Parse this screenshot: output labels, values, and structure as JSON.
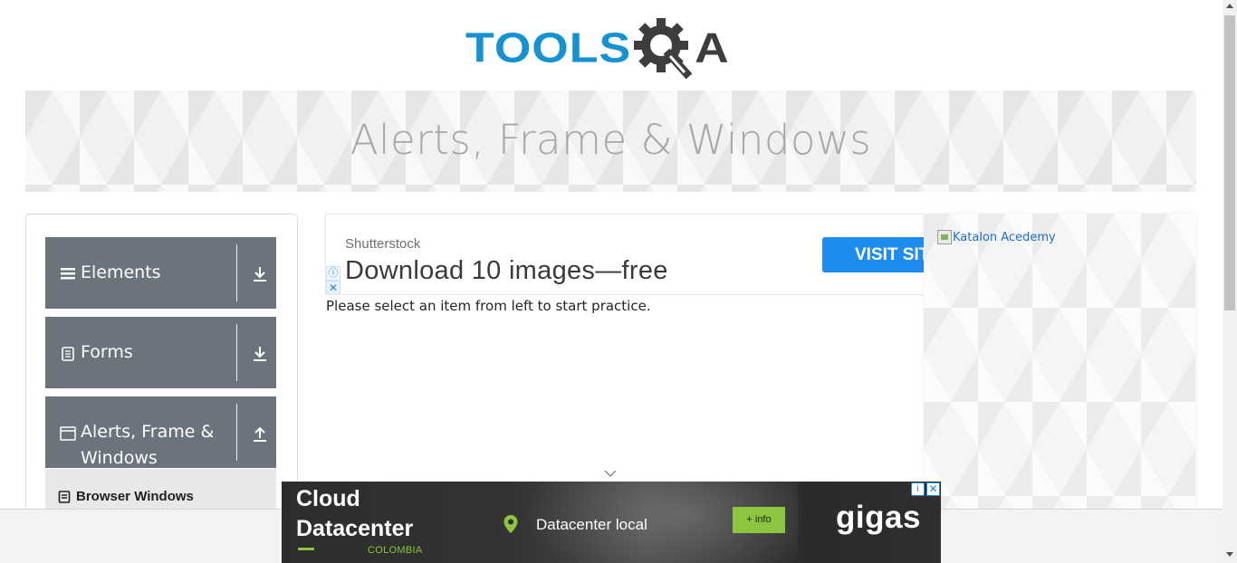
{
  "header": {
    "logo_left": "TOOLS",
    "logo_right": "A"
  },
  "banner": {
    "title": "Alerts, Frame & Windows"
  },
  "sidebar": {
    "groups": [
      {
        "label": "Elements",
        "icon": "hamburger-icon",
        "arrow": "download-arrow-icon"
      },
      {
        "label": "Forms",
        "icon": "document-icon",
        "arrow": "download-arrow-icon"
      },
      {
        "label_line1": "Alerts, Frame &",
        "label_line2": "Windows",
        "icon": "window-icon",
        "arrow": "upload-arrow-icon"
      }
    ],
    "submenu": [
      {
        "label": "Browser Windows",
        "icon": "list-icon"
      }
    ]
  },
  "top_ad": {
    "brand": "Shutterstock",
    "headline": "Download 10 images—free",
    "cta": "VISIT SITE",
    "info_glyph": "ⓘ",
    "close_glyph": "✕"
  },
  "main": {
    "practice_text": "Please select an item from left to start practice."
  },
  "right_ad": {
    "alt_text": "Katalon Acedemy"
  },
  "bottom_ad": {
    "title_line1": "Cloud",
    "title_line2": "Datacenter",
    "country": "COLOMBIA",
    "location_text": "Datacenter local",
    "info_button": "+ info",
    "brand": "gigas",
    "info_glyph": "i",
    "close_glyph": "✕"
  },
  "colors": {
    "brand_blue": "#1592d1",
    "sidebar_header": "#6b737c",
    "cta_blue": "#1e8df2",
    "ad_green": "#8cc63f"
  }
}
